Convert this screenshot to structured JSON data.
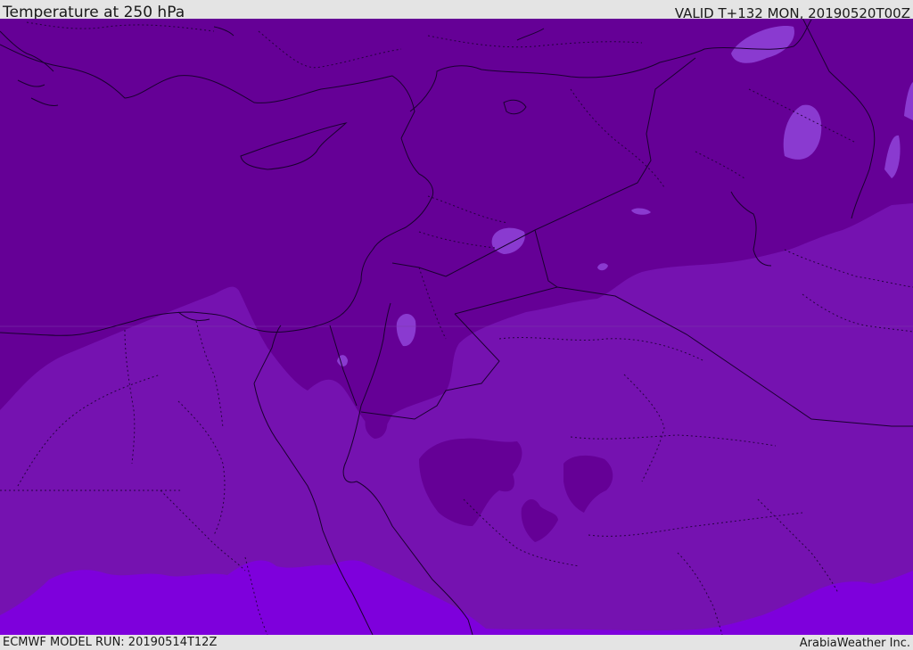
{
  "header": {
    "title": "Temperature at 250 hPa",
    "valid_time": "VALID T+132 MON, 20190520T00Z"
  },
  "footer": {
    "model_run": "ECMWF MODEL RUN: 20190514T12Z",
    "credit": "ArabiaWeather Inc."
  },
  "map": {
    "colors": {
      "dark_band": "#650096",
      "mid_band": "#7512b0",
      "light_band": "#7e00dc",
      "pale_patch": "#8a3ad0",
      "coastline": "#1a0030"
    }
  }
}
